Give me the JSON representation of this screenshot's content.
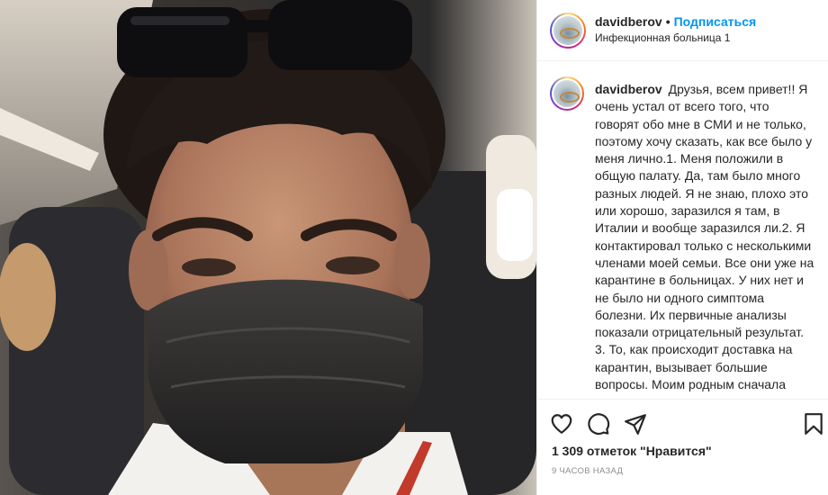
{
  "post": {
    "username": "davidberov",
    "separator": "•",
    "follow_label": "Подписаться",
    "location": "Инфекционная больница 1",
    "caption": "Друзья, всем привет!! Я очень устал от всего того, что говорят обо мне в СМИ и не только, поэтому хочу сказать, как все было у меня лично.1. Меня положили в общую палату. Да, там было много разных людей. Я не знаю, плохо это или хорошо, заразился я там, в Италии и вообще заразился ли.2. Я контактировал только с несколькими членами моей семьи. Все они уже на карантине в больницах. У них нет и не было ни одного симптома болезни. Их первичные анализы показали отрицательный результат. 3. То, как происходит доставка на карантин, вызывает большие вопросы. Моим родным сначала звонили и говорили, что возьмут анализы на дому. Приезжали",
    "likes_text": "1 309 отметок \"Нравится\"",
    "time_text": "9 часов назад"
  },
  "icons": {
    "like": "heart-icon",
    "comment": "comment-icon",
    "share": "share-icon",
    "save": "bookmark-icon"
  }
}
